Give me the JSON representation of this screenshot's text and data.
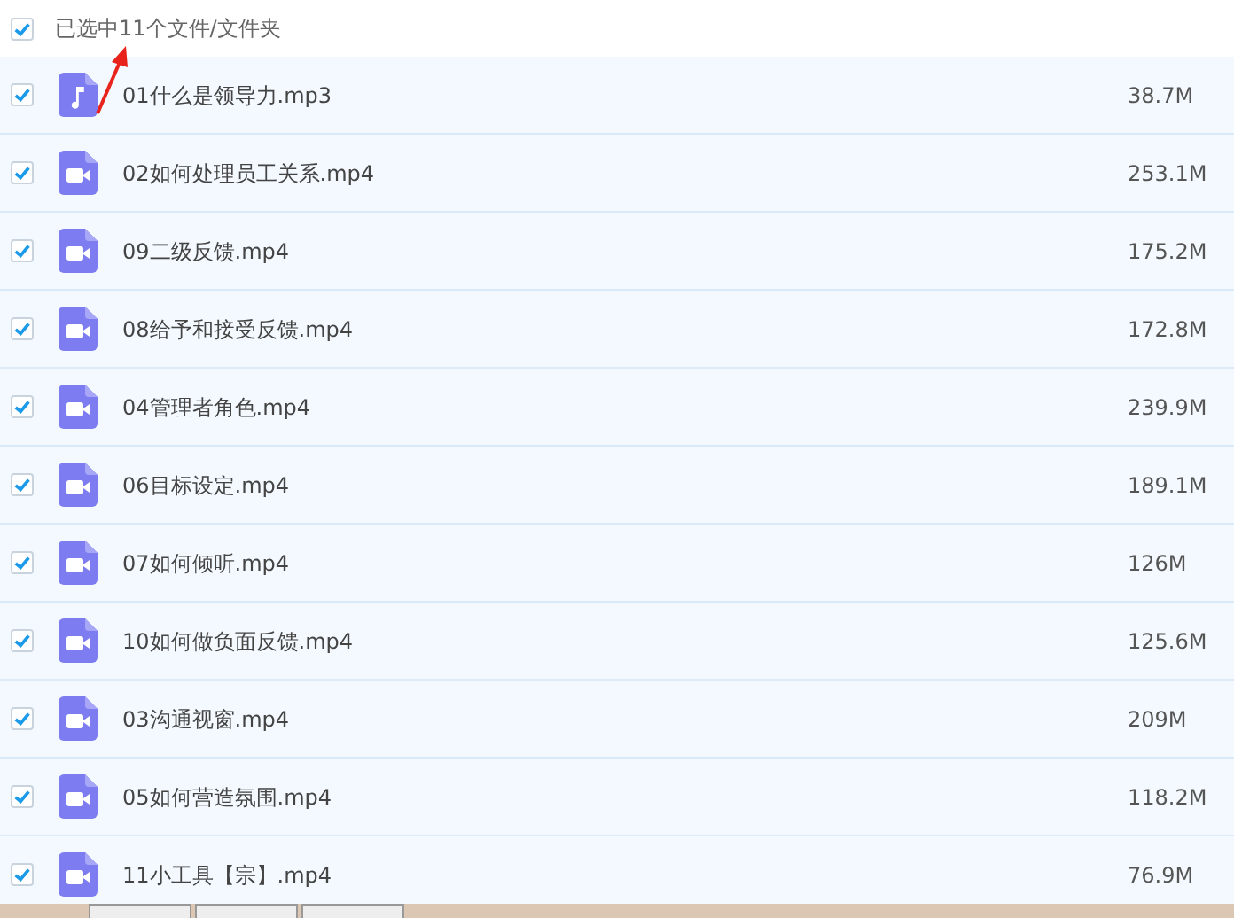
{
  "header": {
    "checked": true,
    "label": "已选中11个文件/文件夹"
  },
  "files": [
    {
      "kind": "audio",
      "name": "01什么是领导力.mp3",
      "size": "38.7M",
      "checked": true
    },
    {
      "kind": "video",
      "name": "02如何处理员工关系.mp4",
      "size": "253.1M",
      "checked": true
    },
    {
      "kind": "video",
      "name": "09二级反馈.mp4",
      "size": "175.2M",
      "checked": true
    },
    {
      "kind": "video",
      "name": "08给予和接受反馈.mp4",
      "size": "172.8M",
      "checked": true
    },
    {
      "kind": "video",
      "name": "04管理者角色.mp4",
      "size": "239.9M",
      "checked": true
    },
    {
      "kind": "video",
      "name": "06目标设定.mp4",
      "size": "189.1M",
      "checked": true
    },
    {
      "kind": "video",
      "name": "07如何倾听.mp4",
      "size": "126M",
      "checked": true
    },
    {
      "kind": "video",
      "name": "10如何做负面反馈.mp4",
      "size": "125.6M",
      "checked": true
    },
    {
      "kind": "video",
      "name": "03沟通视窗.mp4",
      "size": "209M",
      "checked": true
    },
    {
      "kind": "video",
      "name": "05如何营造氛围.mp4",
      "size": "118.2M",
      "checked": true
    },
    {
      "kind": "video",
      "name": "11小工具【宗】.mp4",
      "size": "76.9M",
      "checked": true
    }
  ]
}
